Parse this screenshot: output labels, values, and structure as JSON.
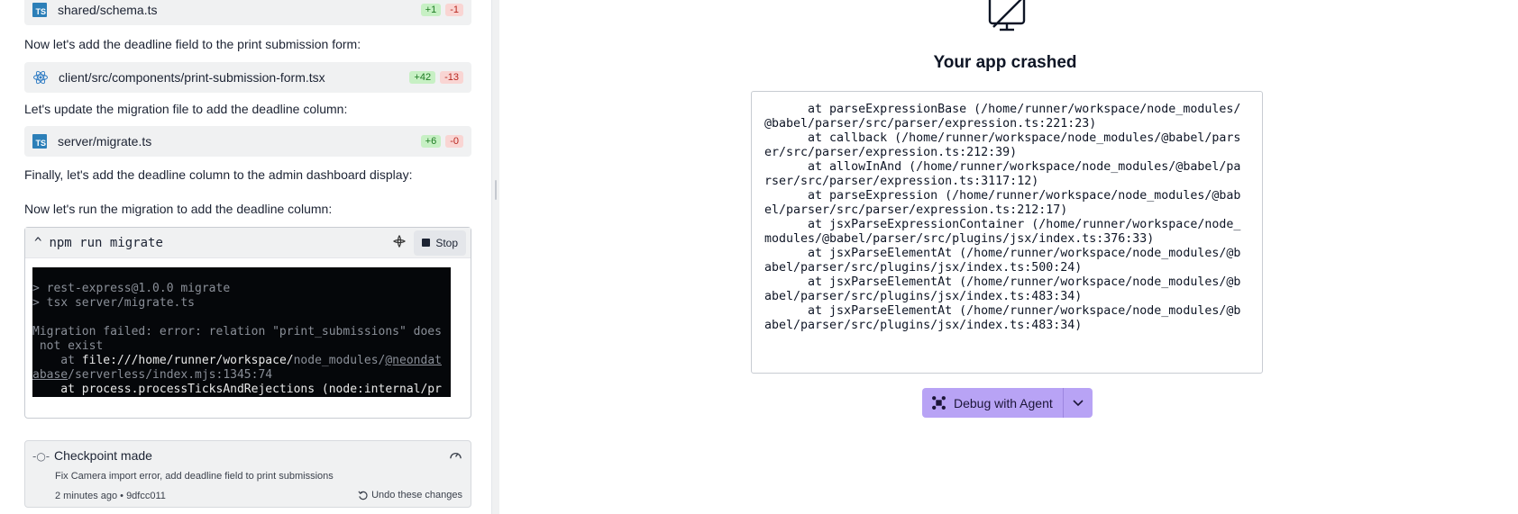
{
  "files": [
    {
      "path": "shared/schema.ts",
      "added": "+1",
      "removed": "-1",
      "kind": "ts"
    },
    {
      "path": "client/src/components/print-submission-form.tsx",
      "added": "+42",
      "removed": "-13",
      "kind": "react"
    },
    {
      "path": "server/migrate.ts",
      "added": "+6",
      "removed": "-0",
      "kind": "ts"
    }
  ],
  "notes": {
    "form": "Now let's add the deadline field to the print submission form:",
    "migration": "Let's update the migration file to add the deadline column:",
    "admin": "Finally, let's add the deadline column to the admin dashboard display:",
    "run": "Now let's run the migration to add the deadline column:"
  },
  "terminal": {
    "caret": "^",
    "command": "npm run migrate",
    "stop_label": "Stop",
    "lines": {
      "l1": "> rest-express@1.0.0 migrate",
      "l2": "> tsx server/migrate.ts",
      "l3a": "Migration failed: error: relation \"print_submissions\" does",
      "l3b": " not exist",
      "l4_prefix": "    at ",
      "l4_white": "file:///home/runner/workspace/",
      "l4_grey": "node_modules/",
      "l4_ul": "@neondat",
      "l5_ul": "abase",
      "l5_rest": "/serverless/index.mjs:1345:74",
      "l6": "    at process.processTicksAndRejections (node:internal/pr"
    }
  },
  "checkpoint": {
    "icon": "-○-",
    "title": "Checkpoint made",
    "description": "Fix Camera import error, add deadline field to print submissions",
    "meta": "2 minutes ago  • 9dfcc011",
    "undo_label": "Undo these changes"
  },
  "crash": {
    "title": "Your app crashed",
    "stack": "      at parseExpressionBase (/home/runner/workspace/node_modules/\n@babel/parser/src/parser/expression.ts:221:23)\n      at callback (/home/runner/workspace/node_modules/@babel/pars\ner/src/parser/expression.ts:212:39)\n      at allowInAnd (/home/runner/workspace/node_modules/@babel/pa\nrser/src/parser/expression.ts:3117:12)\n      at parseExpression (/home/runner/workspace/node_modules/@bab\nel/parser/src/parser/expression.ts:212:17)\n      at jsxParseExpressionContainer (/home/runner/workspace/node_\nmodules/@babel/parser/src/plugins/jsx/index.ts:376:33)\n      at jsxParseElementAt (/home/runner/workspace/node_modules/@b\nabel/parser/src/plugins/jsx/index.ts:500:24)\n      at jsxParseElementAt (/home/runner/workspace/node_modules/@b\nabel/parser/src/plugins/jsx/index.ts:483:34)\n      at jsxParseElementAt (/home/runner/workspace/node_modules/@b\nabel/parser/src/plugins/jsx/index.ts:483:34)",
    "debug_label": "Debug with Agent"
  },
  "colors": {
    "accent_purple": "#b8a3f5",
    "terminal_bg": "#05070a",
    "added": "#c7f0c4",
    "removed": "#f9d5d3"
  }
}
